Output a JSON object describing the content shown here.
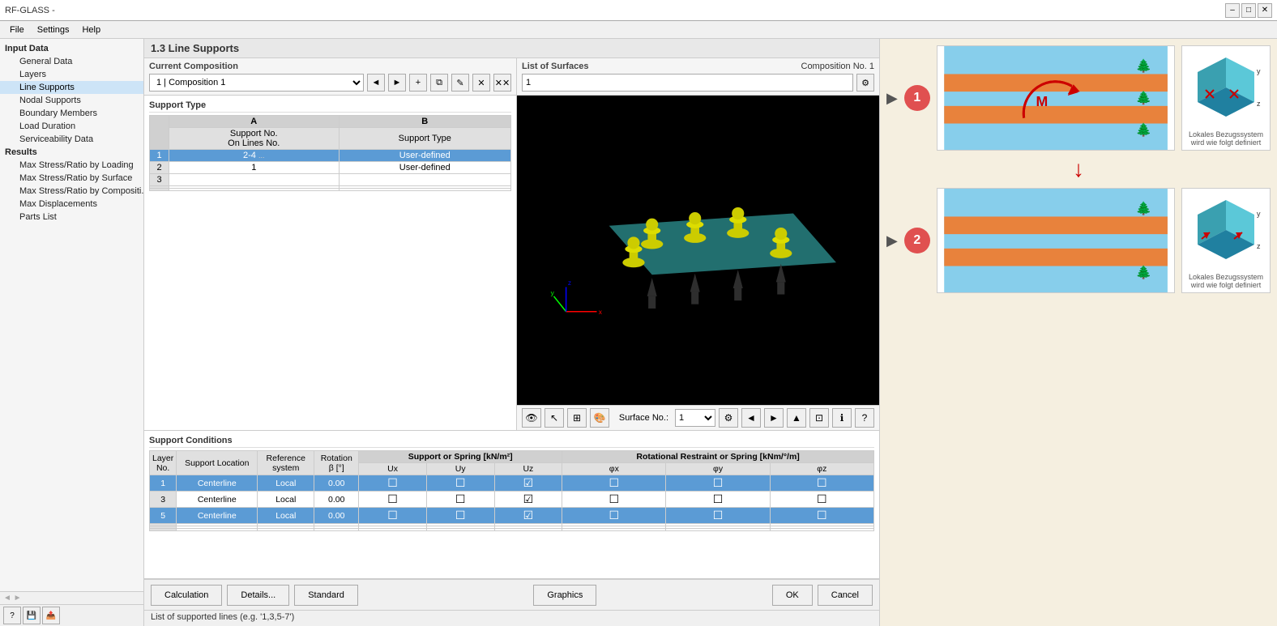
{
  "window": {
    "title": "RF-GLASS -",
    "close_btn": "✕"
  },
  "menu": {
    "items": [
      "File",
      "Settings",
      "Help"
    ]
  },
  "sidebar": {
    "input_label": "Input Data",
    "items": [
      {
        "label": "General Data",
        "indent": 2,
        "active": false
      },
      {
        "label": "Layers",
        "indent": 2,
        "active": false
      },
      {
        "label": "Line Supports",
        "indent": 2,
        "active": true
      },
      {
        "label": "Nodal Supports",
        "indent": 2,
        "active": false
      },
      {
        "label": "Boundary Members",
        "indent": 2,
        "active": false
      },
      {
        "label": "Load Duration",
        "indent": 2,
        "active": false
      },
      {
        "label": "Serviceability Data",
        "indent": 2,
        "active": false
      }
    ],
    "results_label": "Results",
    "results": [
      {
        "label": "Max Stress/Ratio by Loading",
        "indent": 2
      },
      {
        "label": "Max Stress/Ratio by Surface",
        "indent": 2
      },
      {
        "label": "Max Stress/Ratio by Compositi...",
        "indent": 2
      },
      {
        "label": "Max Displacements",
        "indent": 2
      },
      {
        "label": "Parts List",
        "indent": 2
      }
    ]
  },
  "section_title": "1.3 Line Supports",
  "current_composition": {
    "label": "Current Composition",
    "value": "1 | Composition 1"
  },
  "list_of_surfaces": {
    "label": "List of Surfaces",
    "comp_no": "Composition No. 1",
    "value": "1"
  },
  "support_type": {
    "label": "Support Type",
    "col_a": "A",
    "col_b": "B",
    "header_support_no": "Support No.",
    "header_on_lines": "On Lines No.",
    "header_support_type": "Support Type",
    "rows": [
      {
        "no": "1",
        "on_lines": "2-4",
        "type": "User-defined",
        "selected": true
      },
      {
        "no": "2",
        "on_lines": "1",
        "type": "User-defined",
        "selected": false
      },
      {
        "no": "3",
        "on_lines": "",
        "type": "",
        "selected": false
      }
    ]
  },
  "viewport": {
    "surface_label": "Surface No.:",
    "surface_value": "1"
  },
  "support_conditions": {
    "label": "Support Conditions",
    "header_layer_no": "Layer No.",
    "header_support_location": "Support Location",
    "header_reference_system": "Reference system",
    "header_rotation": "Rotation β [°]",
    "header_support_spring": "Support or Spring [kN/m²]",
    "header_ux": "Ux",
    "header_uy": "Uy",
    "header_uz": "Uz",
    "header_rot_restraint": "Rotational Restraint or Spring [kNm/°/m]",
    "header_ox": "φx",
    "header_oy": "φy",
    "header_oz": "φz",
    "rows": [
      {
        "layer": "1",
        "location": "Centerline",
        "ref_sys": "Local",
        "rotation": "0.00",
        "ux": false,
        "uy": false,
        "uz": true,
        "ox": false,
        "oy": false,
        "oz": false,
        "selected": true
      },
      {
        "layer": "3",
        "location": "Centerline",
        "ref_sys": "Local",
        "rotation": "0.00",
        "ux": false,
        "uy": false,
        "uz": true,
        "ox": false,
        "oy": false,
        "oz": false,
        "selected": false
      },
      {
        "layer": "5",
        "location": "Centerline",
        "ref_sys": "Local",
        "rotation": "0.00",
        "ux": false,
        "uy": false,
        "uz": true,
        "ox": false,
        "oy": false,
        "oz": false,
        "selected": true
      }
    ]
  },
  "bottom_toolbar": {
    "calculation": "Calculation",
    "details": "Details...",
    "standard": "Standard",
    "graphics": "Graphics",
    "ok": "OK",
    "cancel": "Cancel"
  },
  "status_bar": "List of supported lines (e.g. '1,3,5-7')",
  "right_panel": {
    "diagram1_label": "1",
    "diagram2_label": "2",
    "iso_label1": "Lokales Bezugssystem\nwird wie folgt definiert",
    "iso_label2": "Lokales Bezugssystem\nwird wie folgt definiert"
  }
}
